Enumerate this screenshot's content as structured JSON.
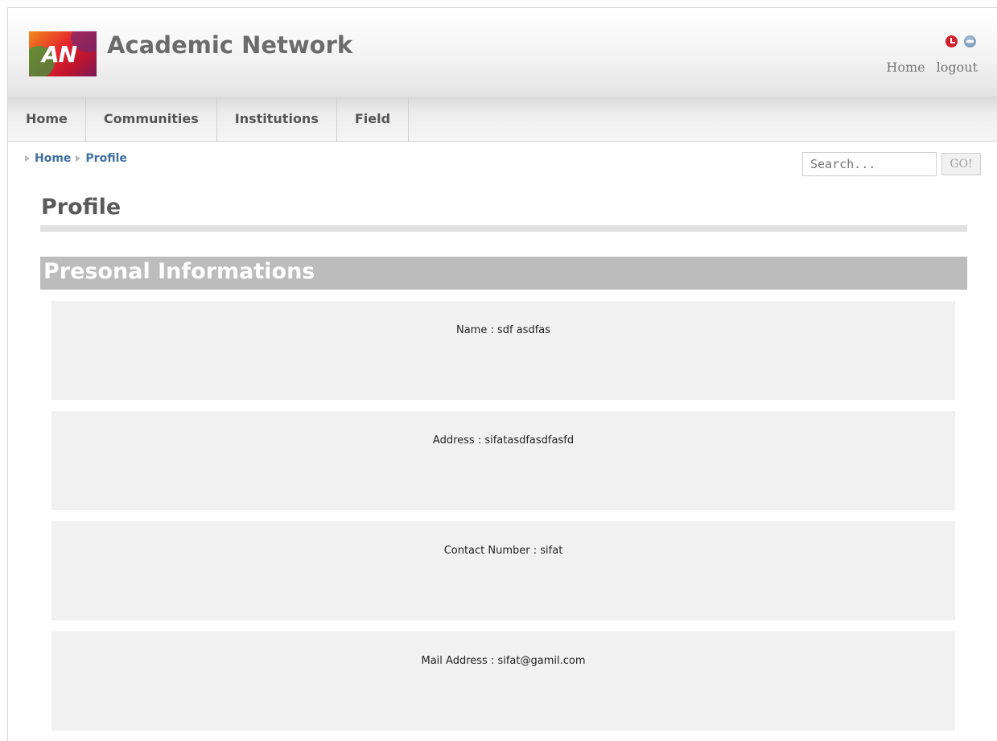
{
  "header": {
    "logo_text": "AN",
    "site_title": "Academic Network",
    "links": [
      "Home",
      "logout"
    ]
  },
  "nav": {
    "items": [
      "Home",
      "Communities",
      "Institutions",
      "Field"
    ]
  },
  "breadcrumb": [
    "Home",
    "Profile"
  ],
  "search": {
    "placeholder": "Search...",
    "button": "GO!"
  },
  "page": {
    "title": "Profile",
    "section_title": "Presonal Informations",
    "fields": [
      "Name : sdf asdfas",
      "Address : sifatasdfasdfasfd",
      "Contact Number : sifat",
      "Mail Address : sifat@gamil.com"
    ]
  },
  "colors": {
    "breadcrumb_link": "#3f6fa0",
    "section_bar": "#bcbcbc",
    "field_bg": "#f1f1f1"
  }
}
